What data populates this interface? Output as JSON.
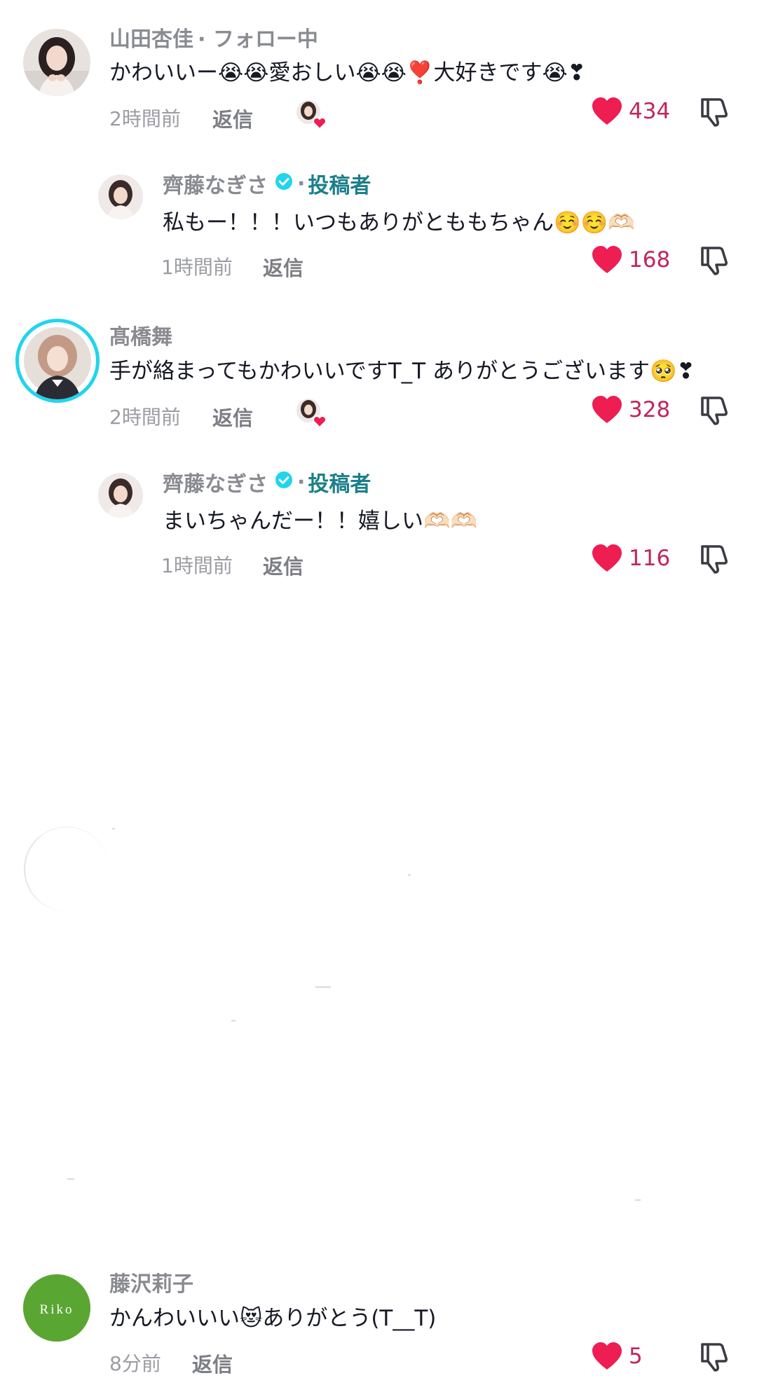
{
  "comments": [
    {
      "name": "山田杏佳",
      "name_suffix": "· フォロー中",
      "text": "かわいいー😭😭愛おしい😭😭❣️大好きです😭❣",
      "time": "2時間前",
      "reply_label": "返信",
      "likes": "434",
      "creator_liked": true
    },
    {
      "name": "齊藤なぎさ",
      "role_label": "投稿者",
      "text": "私もー！！！いつもありがとももちゃん☺️☺️🫶🏻",
      "time": "1時間前",
      "reply_label": "返信",
      "likes": "168"
    },
    {
      "name": "髙橋舞",
      "text": "手が絡まってもかわいいですT_T ありがとうございます🥺❣",
      "time": "2時間前",
      "reply_label": "返信",
      "likes": "328",
      "creator_liked": true
    },
    {
      "name": "齊藤なぎさ",
      "role_label": "投稿者",
      "text": "まいちゃんだー！！嬉しい🫶🏻🫶🏻",
      "time": "1時間前",
      "reply_label": "返信",
      "likes": "116"
    },
    {
      "name": "藤沢莉子",
      "avatar_text": "Riko",
      "text": "かんわいいい😻ありがとう(T__T)",
      "time": "8分前",
      "reply_label": "返信",
      "likes": "5"
    }
  ],
  "icons": {
    "like": "heart-icon",
    "dislike": "thumbs-down-icon",
    "verified": "verified-badge-icon"
  },
  "colors": {
    "heart": "#ee1d52",
    "like_count": "#c0265a",
    "creator_label": "#1b7f8a",
    "verified": "#20d5ec",
    "riko_avatar": "#5aa632"
  }
}
